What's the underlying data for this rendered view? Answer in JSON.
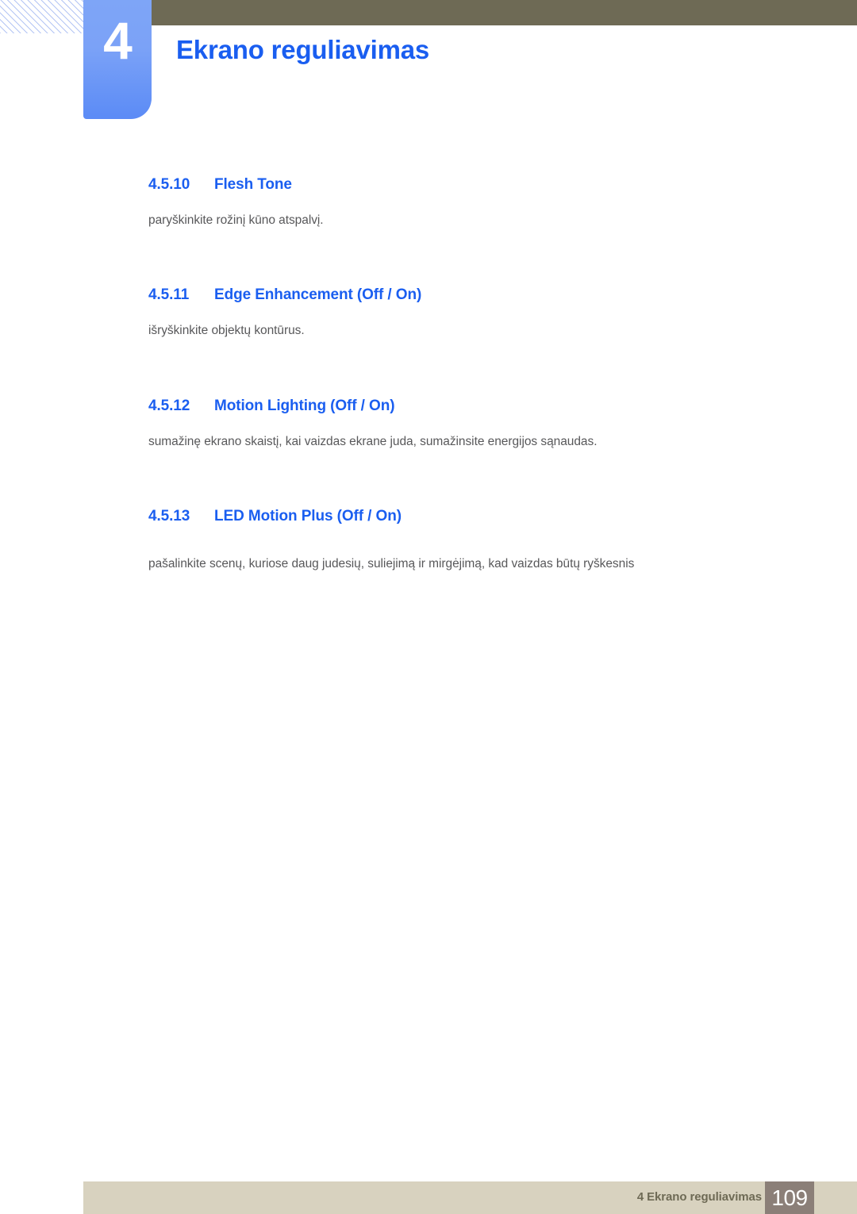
{
  "header": {
    "chapter_number": "4",
    "chapter_title": "Ekrano reguliavimas",
    "bar_color": "#6e6a55",
    "tab_color_top": "#7ea5f7",
    "tab_color_bottom": "#5b8bf6",
    "title_color": "#1a5ef0"
  },
  "sections": [
    {
      "number": "4.5.10",
      "title": "Flesh Tone",
      "body": "paryškinkite rožinį kūno atspalvį."
    },
    {
      "number": "4.5.11",
      "title": "Edge Enhancement (Off / On)",
      "body": "išryškinkite objektų kontūrus."
    },
    {
      "number": "4.5.12",
      "title": "Motion Lighting (Off / On)",
      "body": "sumažinę ekrano skaistį, kai vaizdas ekrane juda, sumažinsite energijos sąnaudas."
    },
    {
      "number": "4.5.13",
      "title": "LED Motion Plus (Off / On)",
      "body": "pašalinkite scenų, kuriose daug judesių, suliejimą ir mirgėjimą, kad vaizdas būtų ryškesnis"
    }
  ],
  "footer": {
    "text": "4 Ekrano reguliavimas",
    "page_number": "109",
    "bar_color": "#d8d2bf",
    "page_box_color": "#8b7f78",
    "text_color": "#6e6a55"
  }
}
